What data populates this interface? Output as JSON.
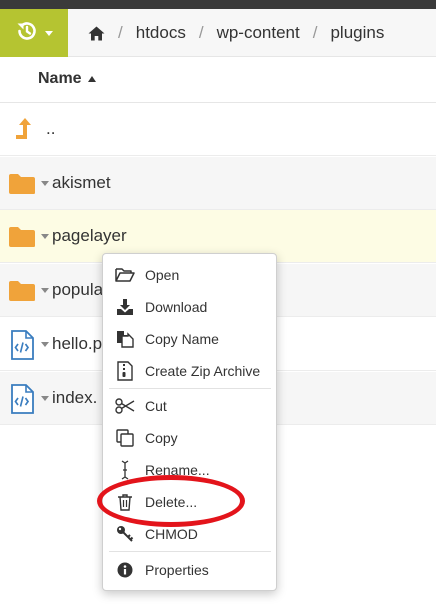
{
  "colors": {
    "accent": "#b5c431",
    "folder": "#f0a33a",
    "parent_arrow": "#f0a33a",
    "file_icon": "#3a7dbf",
    "annotation": "#e3141b"
  },
  "toolbar": {
    "history_icon": "history-icon"
  },
  "breadcrumb": {
    "home_icon": "home-icon",
    "separator": "/",
    "items": [
      "htdocs",
      "wp-content",
      "plugins"
    ]
  },
  "list": {
    "column_name": "Name",
    "sort": "ascending",
    "rows": [
      {
        "name": "..",
        "icon": "level-up-icon",
        "type": "parent"
      },
      {
        "name": "akismet",
        "icon": "folder-icon",
        "type": "folder"
      },
      {
        "name": "pagelayer",
        "icon": "folder-icon",
        "type": "folder",
        "selected": true
      },
      {
        "name": "popula",
        "icon": "folder-icon",
        "type": "folder"
      },
      {
        "name": "hello.p",
        "icon": "code-file-icon",
        "type": "file"
      },
      {
        "name": "index.",
        "icon": "code-file-icon",
        "type": "file"
      }
    ]
  },
  "context_menu": {
    "items": [
      {
        "label": "Open",
        "icon": "folder-open-icon"
      },
      {
        "label": "Download",
        "icon": "download-icon"
      },
      {
        "label": "Copy Name",
        "icon": "copy-name-icon"
      },
      {
        "label": "Create Zip Archive",
        "icon": "zip-file-icon"
      },
      {
        "label": "Cut",
        "icon": "scissors-icon"
      },
      {
        "label": "Copy",
        "icon": "copy-icon"
      },
      {
        "label": "Rename...",
        "icon": "text-cursor-icon"
      },
      {
        "label": "Delete...",
        "icon": "trash-icon"
      },
      {
        "label": "CHMOD",
        "icon": "key-icon"
      },
      {
        "label": "Properties",
        "icon": "info-icon"
      }
    ]
  }
}
